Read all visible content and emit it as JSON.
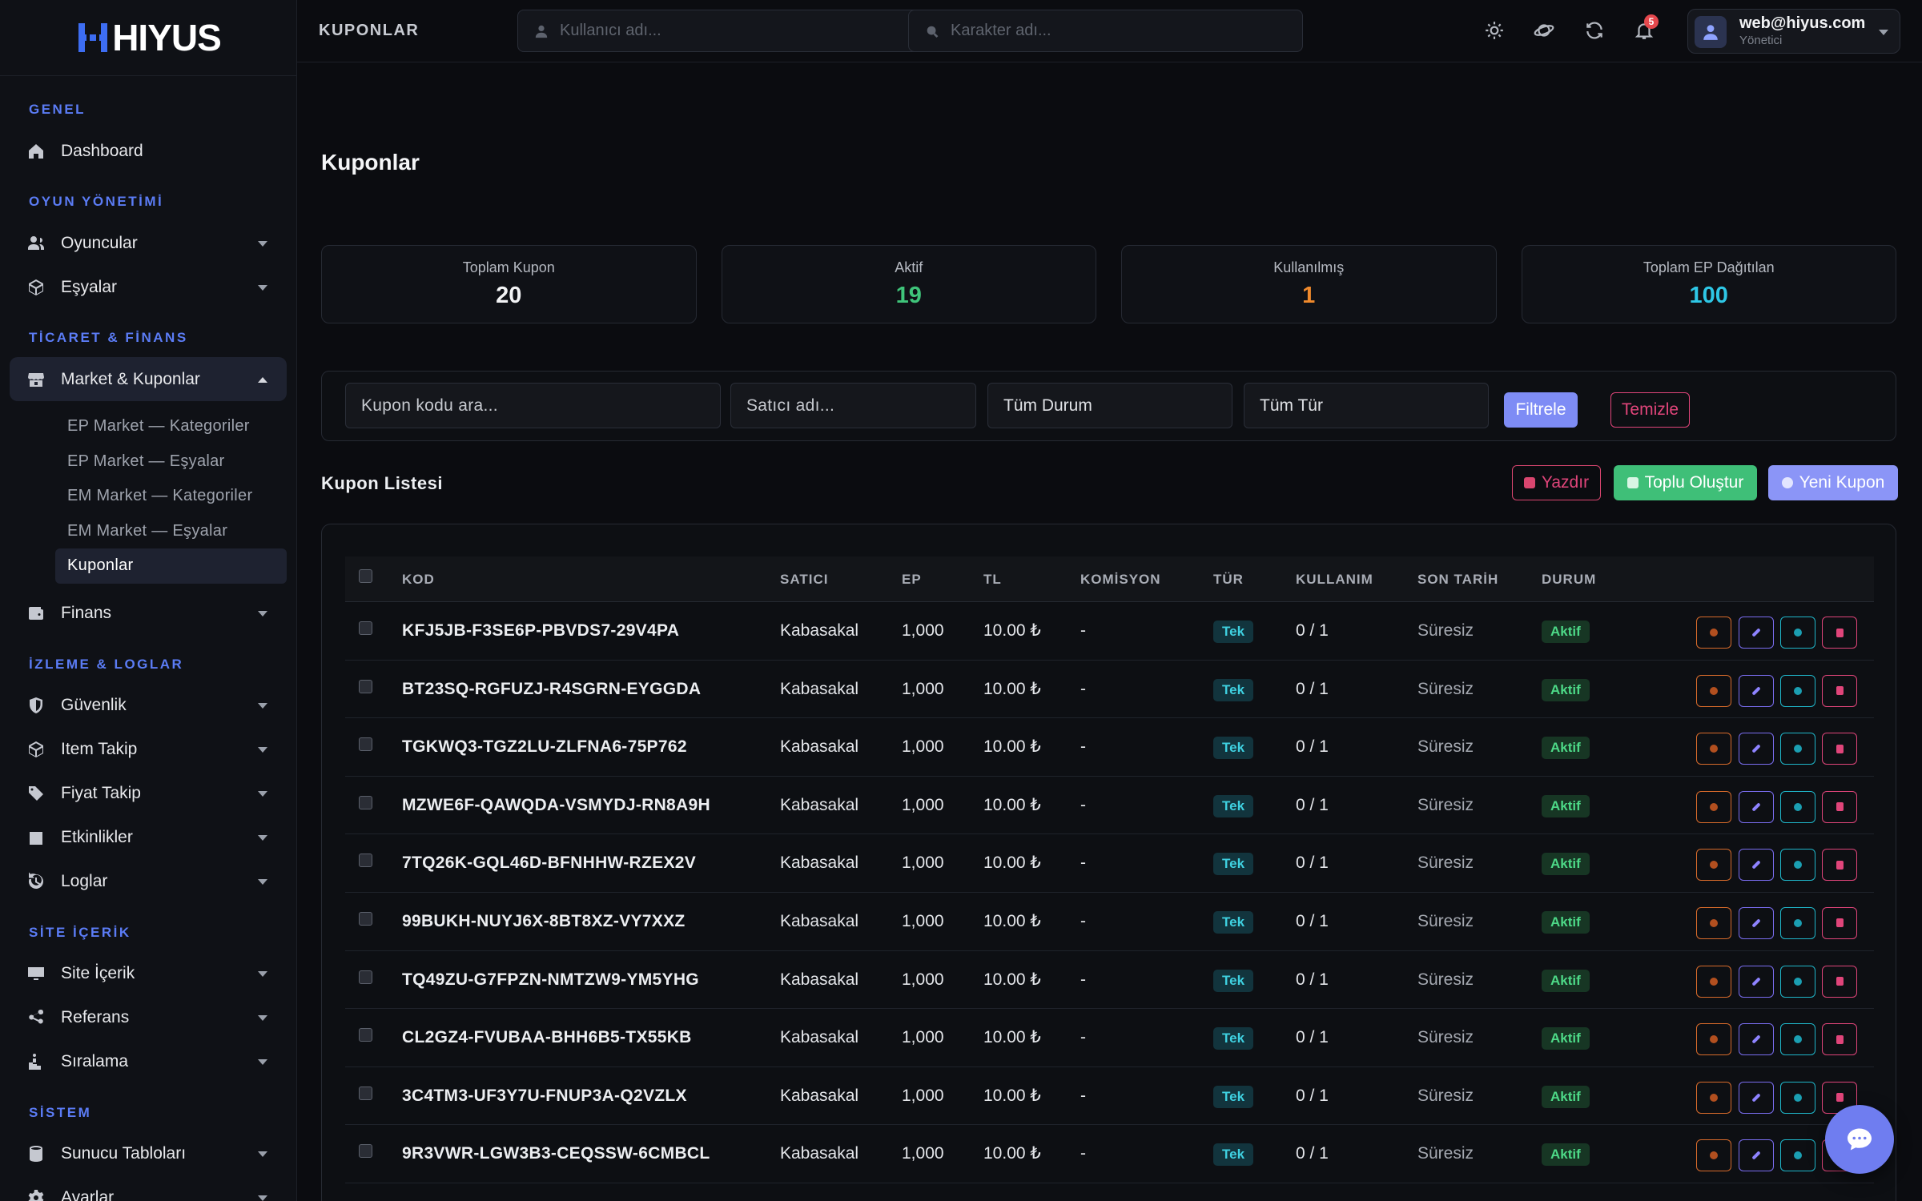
{
  "brand": {
    "name": "HIYUS"
  },
  "sidebar": {
    "sections": [
      {
        "label": "GENEL",
        "items": [
          {
            "label": "Dashboard",
            "icon": "home-icon",
            "caret": false
          }
        ]
      },
      {
        "label": "OYUN YÖNETİMİ",
        "items": [
          {
            "label": "Oyuncular",
            "icon": "users-icon",
            "caret": true
          },
          {
            "label": "Eşyalar",
            "icon": "cube-icon",
            "caret": true
          }
        ]
      },
      {
        "label": "TİCARET & FİNANS",
        "items": [
          {
            "label": "Market & Kuponlar",
            "icon": "store-icon",
            "caret": true,
            "expanded": true,
            "children": [
              "EP Market — Kategoriler",
              "EP Market — Eşyalar",
              "EM Market — Kategoriler",
              "EM Market — Eşyalar",
              "Kuponlar"
            ]
          },
          {
            "label": "Finans",
            "icon": "wallet-icon",
            "caret": true
          }
        ]
      },
      {
        "label": "İZLEME & LOGLAR",
        "items": [
          {
            "label": "Güvenlik",
            "icon": "shield-icon",
            "caret": true
          },
          {
            "label": "Item Takip",
            "icon": "cube-icon",
            "caret": true
          },
          {
            "label": "Fiyat Takip",
            "icon": "tag-icon",
            "caret": true
          },
          {
            "label": "Etkinlikler",
            "icon": "calendar-icon",
            "caret": true
          },
          {
            "label": "Loglar",
            "icon": "history-icon",
            "caret": true
          }
        ]
      },
      {
        "label": "SİTE İÇERİK",
        "items": [
          {
            "label": "Site İçerik",
            "icon": "monitor-icon",
            "caret": true
          },
          {
            "label": "Referans",
            "icon": "share-icon",
            "caret": true
          },
          {
            "label": "Sıralama",
            "icon": "ranking-icon",
            "caret": true
          }
        ]
      },
      {
        "label": "SİSTEM",
        "items": [
          {
            "label": "Sunucu Tabloları",
            "icon": "database-icon",
            "caret": true
          },
          {
            "label": "Ayarlar",
            "icon": "gear-icon",
            "caret": true
          }
        ]
      }
    ],
    "active_child": "Kuponlar"
  },
  "topbar": {
    "breadcrumb": "KUPONLAR",
    "user_search_placeholder": "Kullanıcı adı...",
    "char_search_placeholder": "Karakter adı...",
    "notifications": "5",
    "user_email": "web@hiyus.com",
    "user_role": "Yönetici"
  },
  "page": {
    "title": "Kuponlar"
  },
  "stats": [
    {
      "label": "Toplam Kupon",
      "value": "20",
      "color": "#f2f3f5"
    },
    {
      "label": "Aktif",
      "value": "19",
      "color": "#3fc47a"
    },
    {
      "label": "Kullanılmış",
      "value": "1",
      "color": "#f08a2c"
    },
    {
      "label": "Toplam EP Dağıtılan",
      "value": "100",
      "color": "#2ec7e6"
    }
  ],
  "filters": {
    "code_placeholder": "Kupon kodu ara...",
    "seller_placeholder": "Satıcı adı...",
    "status_value": "Tüm Durum",
    "type_value": "Tüm Tür",
    "filter_label": "Filtrele",
    "clear_label": "Temizle"
  },
  "list": {
    "title": "Kupon Listesi",
    "print_label": "Yazdır",
    "bulk_label": "Toplu Oluştur",
    "new_label": "Yeni Kupon"
  },
  "table": {
    "headers": {
      "kod": "KOD",
      "satici": "SATICI",
      "ep": "EP",
      "tl": "TL",
      "komisyon": "KOMİSYON",
      "tur": "TÜR",
      "kullanim": "KULLANIM",
      "son_tarih": "SON TARİH",
      "durum": "DURUM"
    },
    "rows": [
      {
        "kod": "KFJ5JB-F3SE6P-PBVDS7-29V4PA",
        "satici": "Kabasakal",
        "ep": "1,000",
        "tl": "10.00 ₺",
        "komisyon": "-",
        "tur": "Tek",
        "kullanim": "0 / 1",
        "son_tarih": "Süresiz",
        "durum": "Aktif"
      },
      {
        "kod": "BT23SQ-RGFUZJ-R4SGRN-EYGGDA",
        "satici": "Kabasakal",
        "ep": "1,000",
        "tl": "10.00 ₺",
        "komisyon": "-",
        "tur": "Tek",
        "kullanim": "0 / 1",
        "son_tarih": "Süresiz",
        "durum": "Aktif"
      },
      {
        "kod": "TGKWQ3-TGZ2LU-ZLFNA6-75P762",
        "satici": "Kabasakal",
        "ep": "1,000",
        "tl": "10.00 ₺",
        "komisyon": "-",
        "tur": "Tek",
        "kullanim": "0 / 1",
        "son_tarih": "Süresiz",
        "durum": "Aktif"
      },
      {
        "kod": "MZWE6F-QAWQDA-VSMYDJ-RN8A9H",
        "satici": "Kabasakal",
        "ep": "1,000",
        "tl": "10.00 ₺",
        "komisyon": "-",
        "tur": "Tek",
        "kullanim": "0 / 1",
        "son_tarih": "Süresiz",
        "durum": "Aktif"
      },
      {
        "kod": "7TQ26K-GQL46D-BFNHHW-RZEX2V",
        "satici": "Kabasakal",
        "ep": "1,000",
        "tl": "10.00 ₺",
        "komisyon": "-",
        "tur": "Tek",
        "kullanim": "0 / 1",
        "son_tarih": "Süresiz",
        "durum": "Aktif"
      },
      {
        "kod": "99BUKH-NUYJ6X-8BT8XZ-VY7XXZ",
        "satici": "Kabasakal",
        "ep": "1,000",
        "tl": "10.00 ₺",
        "komisyon": "-",
        "tur": "Tek",
        "kullanim": "0 / 1",
        "son_tarih": "Süresiz",
        "durum": "Aktif"
      },
      {
        "kod": "TQ49ZU-G7FPZN-NMTZW9-YM5YHG",
        "satici": "Kabasakal",
        "ep": "1,000",
        "tl": "10.00 ₺",
        "komisyon": "-",
        "tur": "Tek",
        "kullanim": "0 / 1",
        "son_tarih": "Süresiz",
        "durum": "Aktif"
      },
      {
        "kod": "CL2GZ4-FVUBAA-BHH6B5-TX55KB",
        "satici": "Kabasakal",
        "ep": "1,000",
        "tl": "10.00 ₺",
        "komisyon": "-",
        "tur": "Tek",
        "kullanim": "0 / 1",
        "son_tarih": "Süresiz",
        "durum": "Aktif"
      },
      {
        "kod": "3C4TM3-UF3Y7U-FNUP3A-Q2VZLX",
        "satici": "Kabasakal",
        "ep": "1,000",
        "tl": "10.00 ₺",
        "komisyon": "-",
        "tur": "Tek",
        "kullanim": "0 / 1",
        "son_tarih": "Süresiz",
        "durum": "Aktif"
      },
      {
        "kod": "9R3VWR-LGW3B3-CEQSSW-6CMBCL",
        "satici": "Kabasakal",
        "ep": "1,000",
        "tl": "10.00 ₺",
        "komisyon": "-",
        "tur": "Tek",
        "kullanim": "0 / 1",
        "son_tarih": "Süresiz",
        "durum": "Aktif"
      }
    ]
  },
  "colors": {
    "accent": "#7e8cf5",
    "success": "#3fc47a",
    "warning": "#f08a2c",
    "info": "#2ec7e6",
    "danger": "#e0457a"
  }
}
